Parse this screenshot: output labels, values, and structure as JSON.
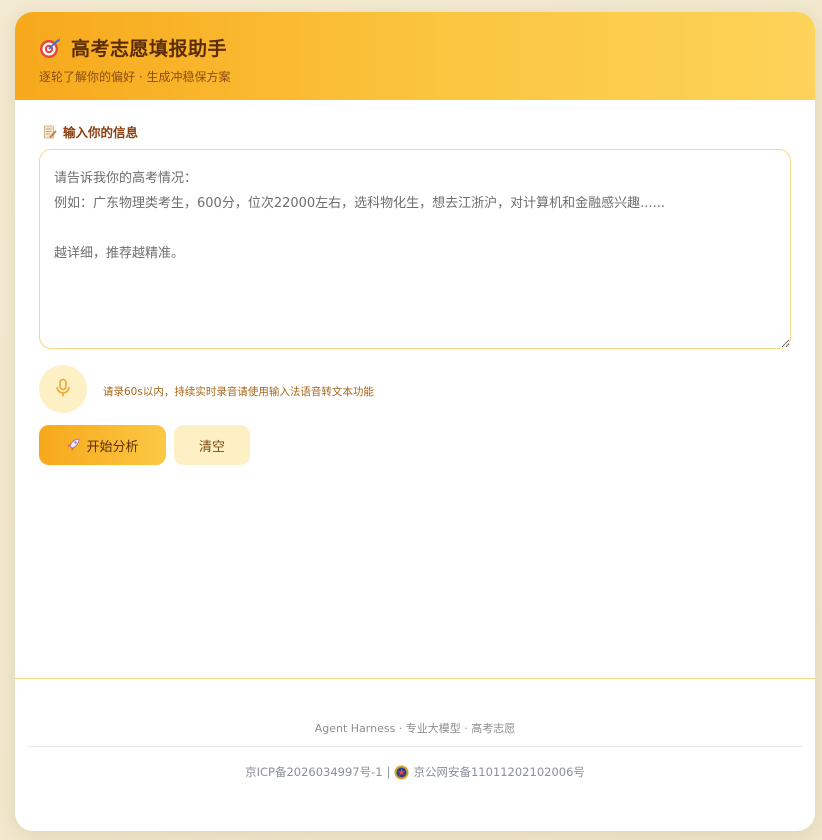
{
  "header": {
    "title": "高考志愿填报助手",
    "subtitle": "逐轮了解你的偏好 · 生成冲稳保方案",
    "icon": "target-icon"
  },
  "input_section": {
    "label": "输入你的信息",
    "icon": "memo-icon",
    "placeholder": "请告诉我你的高考情况：\n例如：广东物理类考生，600分，位次22000左右，选科物化生，想去江浙沪，对计算机和金融感兴趣......\n\n越详细，推荐越精准。",
    "value": ""
  },
  "voice": {
    "icon": "microphone-icon",
    "hint": "请录60s以内，持续实时录音请使用输入法语音转文本功能"
  },
  "actions": {
    "analyze_label": "开始分析",
    "analyze_icon": "rocket-icon",
    "clear_label": "清空"
  },
  "footer": {
    "tagline": "Agent Harness · 专业大模型 · 高考志愿",
    "icp": "京ICP备2026034997号-1",
    "separator": "|",
    "police": "京公网安备11011202102006号"
  },
  "colors": {
    "accent": "#f7a81b",
    "accent_light": "#fdf0c4",
    "title_text": "#5a2d07"
  }
}
